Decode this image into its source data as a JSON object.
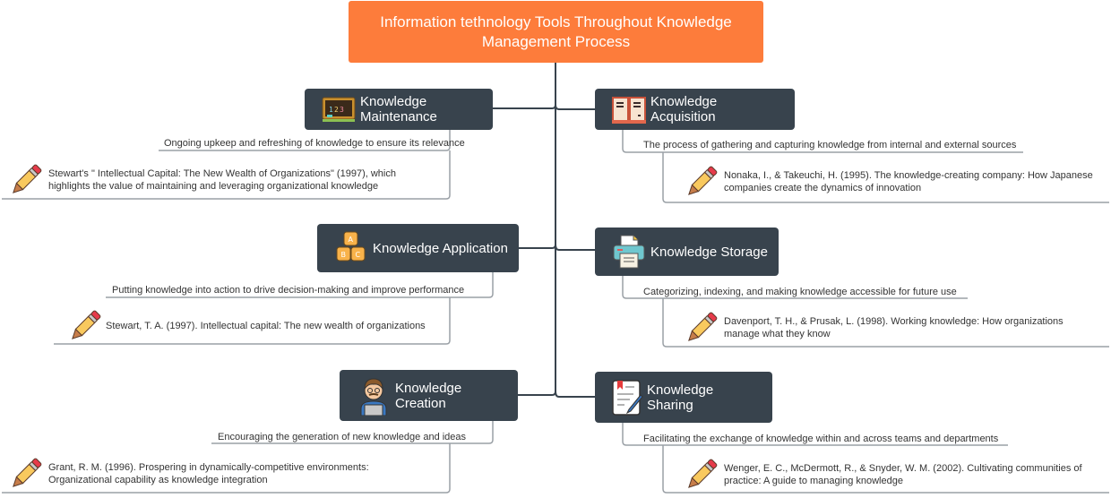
{
  "root": {
    "title": "Information tethnology Tools Throughout Knowledge Management Process"
  },
  "colors": {
    "root": "#fd7c3b",
    "topic": "#38434d",
    "line": "#38434d",
    "subline": "#9aa0a6"
  },
  "topics": [
    {
      "label": "Knowledge Maintenance",
      "icon": "chalkboard-icon",
      "description": "Ongoing upkeep and refreshing of knowledge to ensure its relevance",
      "reference": "Stewart's \" Intellectual Capital: The New Wealth of Organizations\" (1997), which highlights the value of maintaining and leveraging organizational knowledge"
    },
    {
      "label": "Knowledge Acquisition",
      "icon": "open-book-icon",
      "description": "The process of gathering and capturing knowledge from internal and external sources",
      "reference": "Nonaka, I., & Takeuchi, H. (1995). The knowledge-creating company: How Japanese companies create the dynamics of innovation"
    },
    {
      "label": "Knowledge Application",
      "icon": "abc-blocks-icon",
      "description": "Putting knowledge into action to drive decision-making and improve performance",
      "reference": "Stewart, T. A. (1997). Intellectual capital: The new wealth of organizations"
    },
    {
      "label": "Knowledge Storage",
      "icon": "printer-icon",
      "description": "Categorizing, indexing, and making knowledge accessible for future use",
      "reference": "Davenport, T. H., & Prusak, L. (1998). Working knowledge: How organizations manage what they know"
    },
    {
      "label": "Knowledge Creation",
      "icon": "person-laptop-icon",
      "description": "Encouraging the generation of new knowledge and ideas",
      "reference": "Grant, R. M. (1996). Prospering in dynamically-competitive environments: Organizational capability as knowledge integration"
    },
    {
      "label": "Knowledge Sharing",
      "icon": "document-pen-icon",
      "description": "Facilitating the exchange of knowledge within and across teams and departments",
      "reference": "Wenger, E. C., McDermott, R., & Snyder, W. M. (2002). Cultivating communities of practice: A guide to managing knowledge"
    }
  ]
}
